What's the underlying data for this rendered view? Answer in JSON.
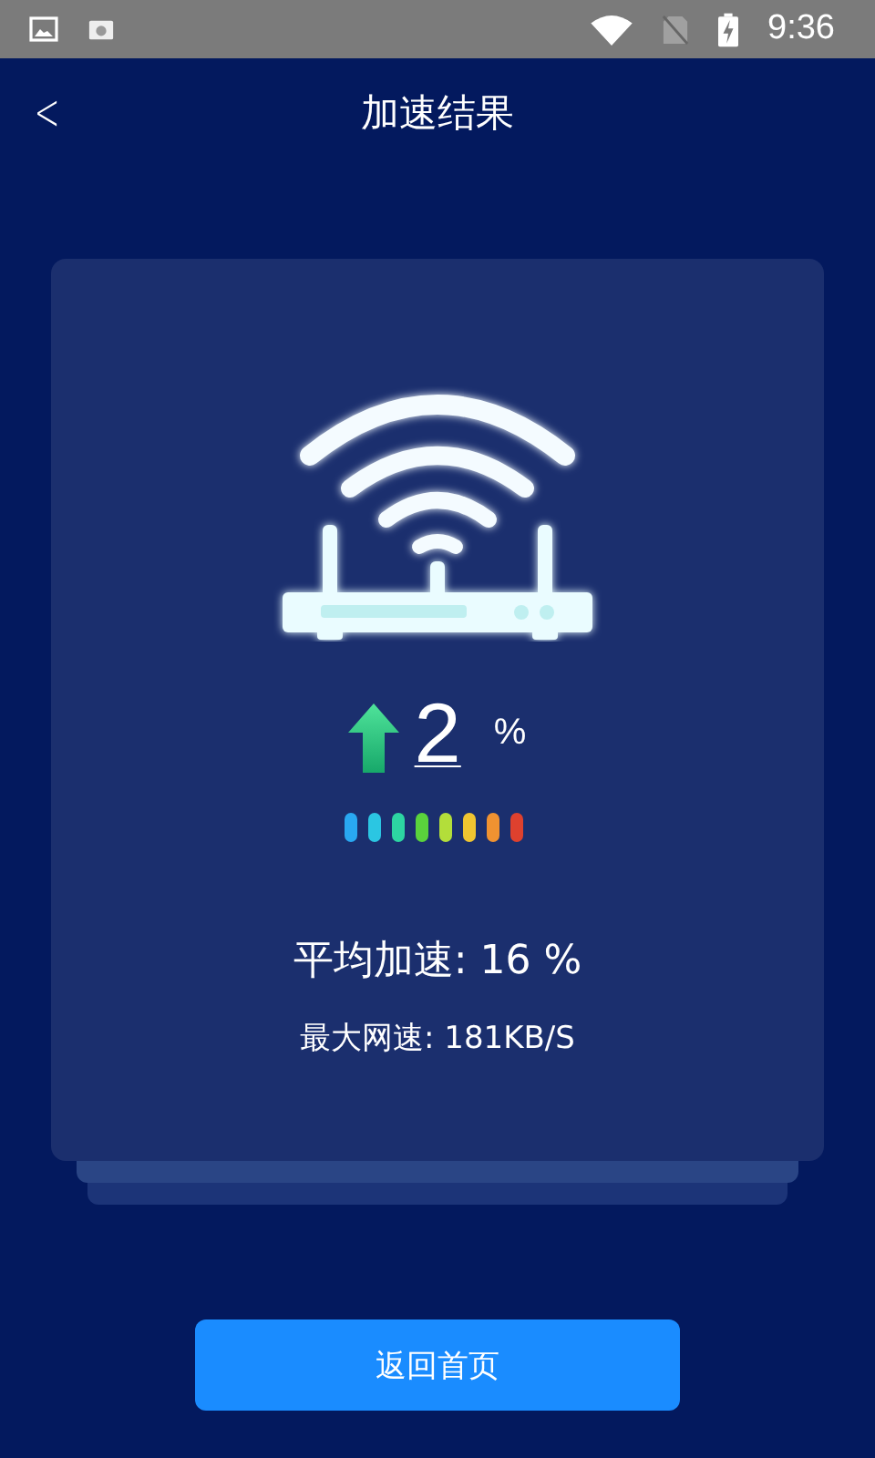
{
  "status_bar": {
    "time": "9:36"
  },
  "header": {
    "back": "<",
    "title": "加速结果"
  },
  "result": {
    "boost": "2",
    "unit": "%",
    "average": "平均加速: 16 %",
    "max_speed": "最大网速: 181KB/S"
  },
  "button": {
    "label": "返回首页"
  }
}
